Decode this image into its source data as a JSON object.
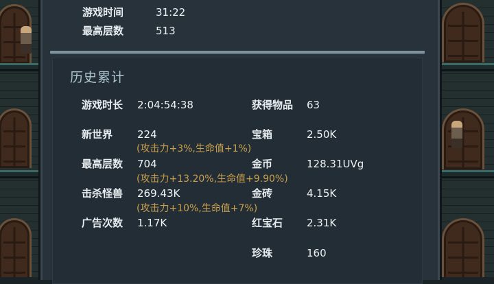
{
  "current": {
    "rows": [
      {
        "label": "游戏时间",
        "value": "31:22"
      },
      {
        "label": "最高层数",
        "value": "513"
      }
    ]
  },
  "history": {
    "title": "历史累计",
    "left": [
      {
        "label": "游戏时长",
        "value": "2:04:54:38",
        "bonus": ""
      },
      {
        "label": "新世界",
        "value": "224",
        "bonus": "(攻击力+3%,生命值+1%)"
      },
      {
        "label": "最高层数",
        "value": "704",
        "bonus": "(攻击力+13.20%,生命值+9.90%)"
      },
      {
        "label": "击杀怪兽",
        "value": "269.43K",
        "bonus": "(攻击力+10%,生命值+7%)"
      },
      {
        "label": "广告次数",
        "value": "1.17K",
        "bonus": ""
      }
    ],
    "right": [
      {
        "label": "获得物品",
        "value": "63"
      },
      {
        "label": "宝箱",
        "value": "2.50K"
      },
      {
        "label": "金币",
        "value": "128.31UVg"
      },
      {
        "label": "金砖",
        "value": "4.15K"
      },
      {
        "label": "红宝石",
        "value": "2.31K"
      },
      {
        "label": "珍珠",
        "value": "160"
      }
    ]
  },
  "colors": {
    "panel": "#27323b",
    "label": "#e6ecef",
    "bonus": "#c9a04d",
    "title": "#aec6cf"
  }
}
